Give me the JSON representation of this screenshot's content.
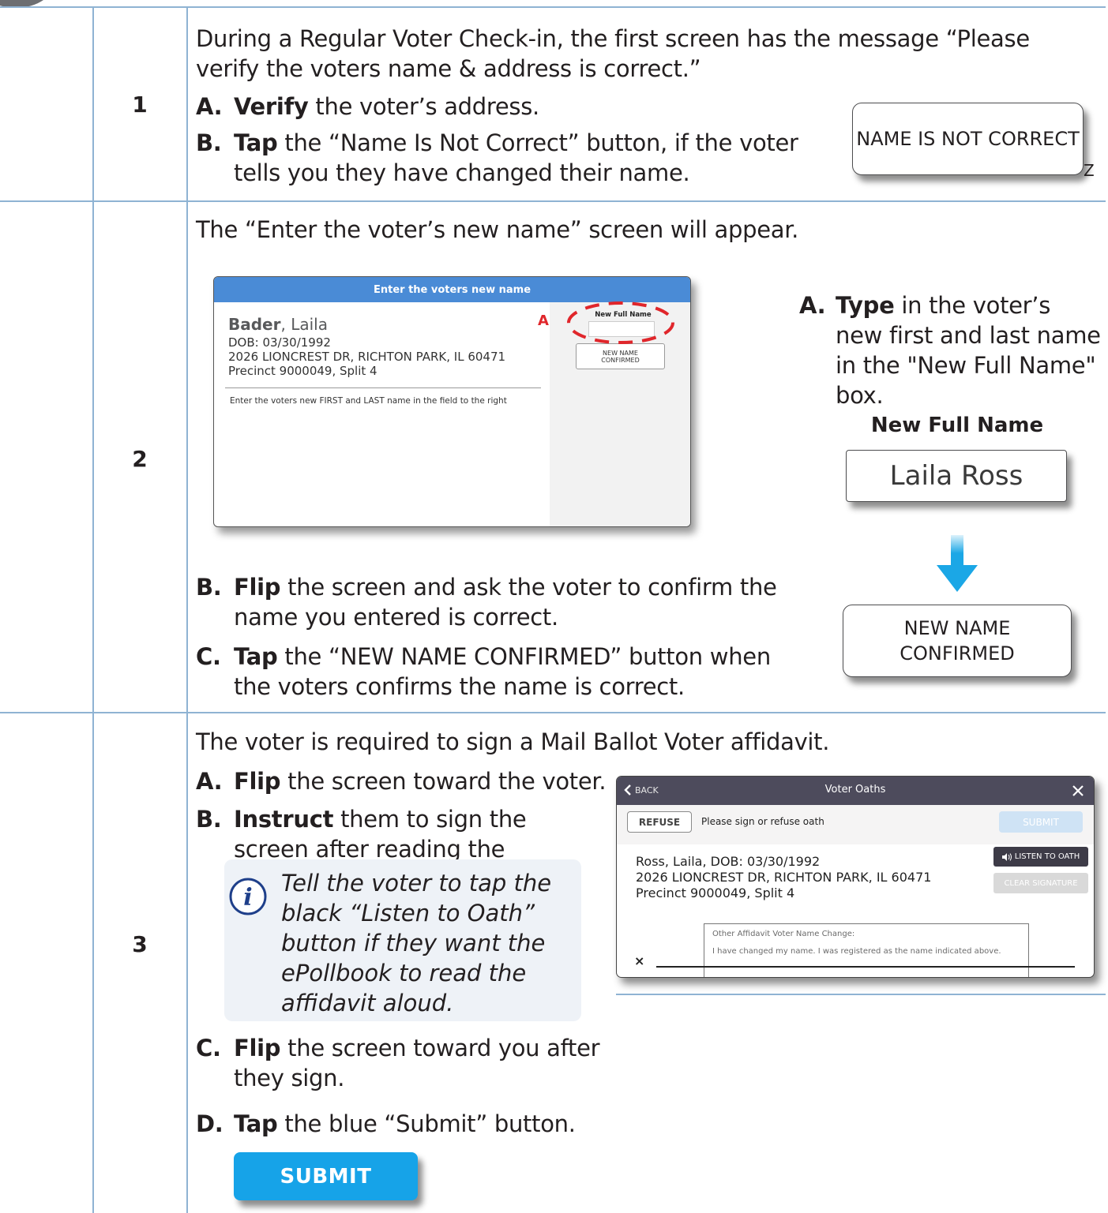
{
  "steps": [
    {
      "number": "1",
      "intro": "During a Regular Voter Check-in, the first screen has the message “Please verify the voters name & address is correct.”",
      "items": [
        {
          "label": "A.",
          "bold": "Verify",
          "rest": " the voter’s address."
        },
        {
          "label": "B.",
          "bold": "Tap",
          "rest": " the “Name Is Not Correct” button, if the voter tells you they have changed their name."
        }
      ],
      "callout_button": "NAME IS NOT CORRECT",
      "stray_mark": "Z"
    },
    {
      "number": "2",
      "intro": "The “Enter the voter’s new name” screen will appear.",
      "screen": {
        "header": "Enter the voters new name",
        "last_name": "Bader",
        "first_name": ", Laila",
        "dob": "DOB: 03/30/1992",
        "address": "2026 LIONCREST DR, RICHTON PARK, IL 60471",
        "precinct": "Precinct 9000049, Split 4",
        "instruction": "Enter the voters new FIRST and LAST name in the field to the right",
        "field_label": "New Full Name",
        "confirm_btn_line1": "NEW NAME",
        "confirm_btn_line2": "CONFIRMED",
        "marker": "A"
      },
      "right_item": {
        "label": "A.",
        "bold": "Type",
        "rest": " in the voter’s new first and last name in the \"New Full Name\" box."
      },
      "field_title": "New Full Name",
      "field_value": "Laila Ross",
      "confirm_line1": "NEW NAME",
      "confirm_line2": "CONFIRMED",
      "items": [
        {
          "label": "B.",
          "bold": "Flip",
          "rest": " the screen and ask the voter to confirm the name you entered is correct."
        },
        {
          "label": "C.",
          "bold": "Tap",
          "rest": " the “NEW NAME CONFIRMED” button when the voters confirms the name is correct."
        }
      ]
    },
    {
      "number": "3",
      "intro": "The voter is required to sign a Mail Ballot Voter affidavit.",
      "items": [
        {
          "label": "A.",
          "bold": "Flip",
          "rest": " the screen toward the voter."
        },
        {
          "label": "B.",
          "bold": "Instruct",
          "rest": " them to sign the screen after reading the affidavit."
        },
        {
          "label": "C.",
          "bold": "Flip",
          "rest": " the screen toward you after they sign."
        },
        {
          "label": "D.",
          "bold": "Tap",
          "rest": " the blue “Submit” button."
        }
      ],
      "tip": "Tell the voter to tap the black “Listen to Oath” button if they want the ePollbook to read the affidavit aloud.",
      "submit_label": "SUBMIT",
      "screen": {
        "back": "BACK",
        "title": "Voter Oaths",
        "refuse": "REFUSE",
        "prompt": "Please sign or refuse oath",
        "submit": "SUBMIT",
        "voter_line": "Ross, Laila, DOB: 03/30/1992",
        "address": "2026 LIONCREST DR, RICHTON PARK, IL 60471",
        "precinct": "Precinct 9000049, Split 4",
        "listen": "LISTEN TO OATH",
        "clear": "CLEAR SIGNATURE",
        "affidavit_title": "Other Affidavit Voter Name Change:",
        "affidavit_text": "I have changed my name.  I was registered as the name indicated above.",
        "sign_x": "×"
      }
    }
  ],
  "colors": {
    "rule": "#8fb3d3",
    "screen_header_blue": "#4a8bd6",
    "oath_bar": "#4d4b5c",
    "submit_blue": "#16a3e8",
    "arrow_blue": "#1ba7e6",
    "marker_red": "#e0262b"
  },
  "icons": [
    "info-icon",
    "down-arrow-icon",
    "chevron-left-icon",
    "close-icon",
    "speaker-icon"
  ]
}
